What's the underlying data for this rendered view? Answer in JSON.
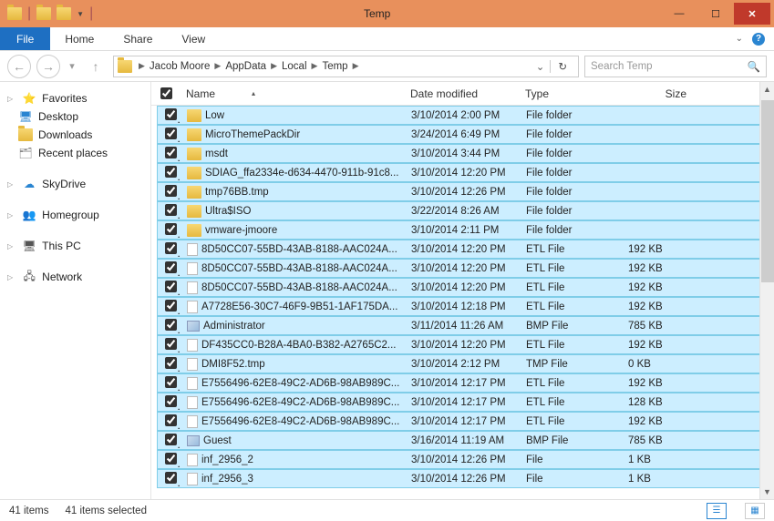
{
  "window": {
    "title": "Temp"
  },
  "ribbon": {
    "file": "File",
    "tabs": [
      "Home",
      "Share",
      "View"
    ]
  },
  "breadcrumbs": [
    "Jacob Moore",
    "AppData",
    "Local",
    "Temp"
  ],
  "search": {
    "placeholder": "Search Temp"
  },
  "sidebar": {
    "favorites": {
      "label": "Favorites",
      "items": [
        "Desktop",
        "Downloads",
        "Recent places"
      ]
    },
    "skydrive": "SkyDrive",
    "homegroup": "Homegroup",
    "thispc": "This PC",
    "network": "Network"
  },
  "columns": {
    "name": "Name",
    "date": "Date modified",
    "type": "Type",
    "size": "Size"
  },
  "files": [
    {
      "name": "Low",
      "date": "3/10/2014 2:00 PM",
      "type": "File folder",
      "size": "",
      "icon": "folder"
    },
    {
      "name": "MicroThemePackDir",
      "date": "3/24/2014 6:49 PM",
      "type": "File folder",
      "size": "",
      "icon": "folder"
    },
    {
      "name": "msdt",
      "date": "3/10/2014 3:44 PM",
      "type": "File folder",
      "size": "",
      "icon": "folder"
    },
    {
      "name": "SDIAG_ffa2334e-d634-4470-911b-91c8...",
      "date": "3/10/2014 12:20 PM",
      "type": "File folder",
      "size": "",
      "icon": "folder"
    },
    {
      "name": "tmp76BB.tmp",
      "date": "3/10/2014 12:26 PM",
      "type": "File folder",
      "size": "",
      "icon": "folder"
    },
    {
      "name": "Ultra$ISO",
      "date": "3/22/2014 8:26 AM",
      "type": "File folder",
      "size": "",
      "icon": "folder"
    },
    {
      "name": "vmware-jmoore",
      "date": "3/10/2014 2:11 PM",
      "type": "File folder",
      "size": "",
      "icon": "folder"
    },
    {
      "name": "8D50CC07-55BD-43AB-8188-AAC024A...",
      "date": "3/10/2014 12:20 PM",
      "type": "ETL File",
      "size": "192 KB",
      "icon": "file"
    },
    {
      "name": "8D50CC07-55BD-43AB-8188-AAC024A...",
      "date": "3/10/2014 12:20 PM",
      "type": "ETL File",
      "size": "192 KB",
      "icon": "file"
    },
    {
      "name": "8D50CC07-55BD-43AB-8188-AAC024A...",
      "date": "3/10/2014 12:20 PM",
      "type": "ETL File",
      "size": "192 KB",
      "icon": "file"
    },
    {
      "name": "A7728E56-30C7-46F9-9B51-1AF175DA...",
      "date": "3/10/2014 12:18 PM",
      "type": "ETL File",
      "size": "192 KB",
      "icon": "file"
    },
    {
      "name": "Administrator",
      "date": "3/11/2014 11:26 AM",
      "type": "BMP File",
      "size": "785 KB",
      "icon": "bmp"
    },
    {
      "name": "DF435CC0-B28A-4BA0-B382-A2765C2...",
      "date": "3/10/2014 12:20 PM",
      "type": "ETL File",
      "size": "192 KB",
      "icon": "file"
    },
    {
      "name": "DMI8F52.tmp",
      "date": "3/10/2014 2:12 PM",
      "type": "TMP File",
      "size": "0 KB",
      "icon": "file"
    },
    {
      "name": "E7556496-62E8-49C2-AD6B-98AB989C...",
      "date": "3/10/2014 12:17 PM",
      "type": "ETL File",
      "size": "192 KB",
      "icon": "file"
    },
    {
      "name": "E7556496-62E8-49C2-AD6B-98AB989C...",
      "date": "3/10/2014 12:17 PM",
      "type": "ETL File",
      "size": "128 KB",
      "icon": "file"
    },
    {
      "name": "E7556496-62E8-49C2-AD6B-98AB989C...",
      "date": "3/10/2014 12:17 PM",
      "type": "ETL File",
      "size": "192 KB",
      "icon": "file"
    },
    {
      "name": "Guest",
      "date": "3/16/2014 11:19 AM",
      "type": "BMP File",
      "size": "785 KB",
      "icon": "bmp"
    },
    {
      "name": "inf_2956_2",
      "date": "3/10/2014 12:26 PM",
      "type": "File",
      "size": "1 KB",
      "icon": "file"
    },
    {
      "name": "inf_2956_3",
      "date": "3/10/2014 12:26 PM",
      "type": "File",
      "size": "1 KB",
      "icon": "file"
    }
  ],
  "status": {
    "count": "41 items",
    "selected": "41 items selected"
  }
}
